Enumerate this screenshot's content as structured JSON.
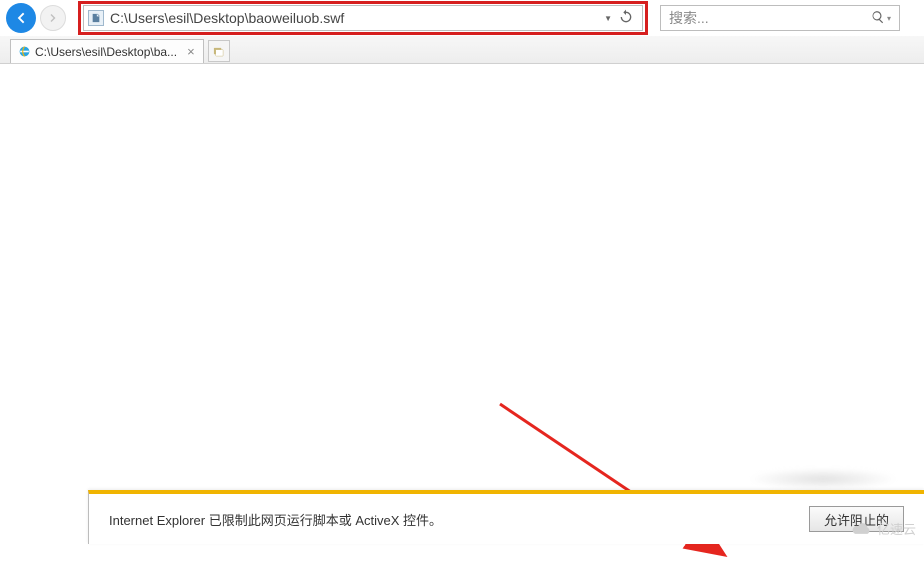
{
  "nav": {
    "address": "C:\\Users\\esil\\Desktop\\baoweiluob.swf",
    "search_placeholder": "搜索..."
  },
  "tabs": {
    "active": {
      "title": "C:\\Users\\esil\\Desktop\\ba..."
    }
  },
  "security_bar": {
    "message": "Internet Explorer 已限制此网页运行脚本或 ActiveX 控件。",
    "allow_label": "允许阻止的"
  },
  "watermark": {
    "text": "亿速云"
  },
  "icons": {
    "back": "back-arrow-icon",
    "forward": "forward-arrow-icon",
    "page": "page-icon",
    "refresh": "refresh-icon",
    "search": "search-icon",
    "ie": "ie-icon",
    "close": "close-icon",
    "newtab": "new-tab-icon",
    "dropdown": "chevron-down-icon"
  }
}
